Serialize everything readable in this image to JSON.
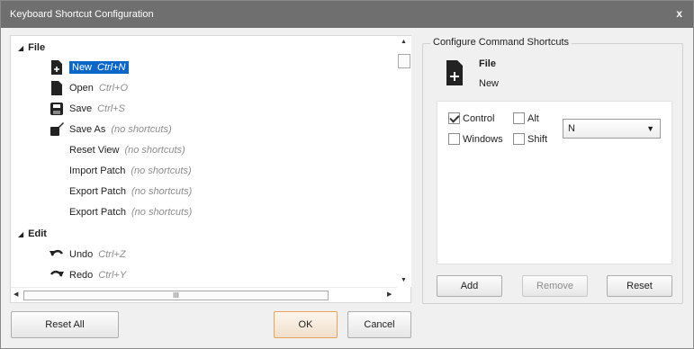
{
  "window": {
    "title": "Keyboard Shortcut Configuration",
    "close_label": "x"
  },
  "tree": {
    "groups": [
      {
        "label": "File",
        "items": [
          {
            "name": "New",
            "shortcut": "Ctrl+N",
            "icon": "new-file-icon",
            "selected": true
          },
          {
            "name": "Open",
            "shortcut": "Ctrl+O",
            "icon": "open-file-icon"
          },
          {
            "name": "Save",
            "shortcut": "Ctrl+S",
            "icon": "save-icon"
          },
          {
            "name": "Save As",
            "shortcut": "(no shortcuts)",
            "icon": "save-as-icon"
          },
          {
            "name": "Reset View",
            "shortcut": "(no shortcuts)"
          },
          {
            "name": "Import Patch",
            "shortcut": "(no shortcuts)"
          },
          {
            "name": "Export Patch",
            "shortcut": "(no shortcuts)"
          },
          {
            "name": "Export Patch",
            "shortcut": "(no shortcuts)"
          }
        ]
      },
      {
        "label": "Edit",
        "items": [
          {
            "name": "Undo",
            "shortcut": "Ctrl+Z",
            "icon": "undo-icon"
          },
          {
            "name": "Redo",
            "shortcut": "Ctrl+Y",
            "icon": "redo-icon"
          }
        ]
      }
    ],
    "hscroll_grip": "III"
  },
  "buttons": {
    "reset_all": "Reset All",
    "ok": "OK",
    "cancel": "Cancel"
  },
  "panel": {
    "title": "Configure Command Shortcuts",
    "command_group": "File",
    "command_name": "New",
    "modifiers": {
      "control": {
        "label": "Control",
        "checked": true
      },
      "alt": {
        "label": "Alt",
        "checked": false
      },
      "windows": {
        "label": "Windows",
        "checked": false
      },
      "shift": {
        "label": "Shift",
        "checked": false
      }
    },
    "key_value": "N",
    "add_label": "Add",
    "remove_label": "Remove",
    "reset_label": "Reset"
  },
  "colors": {
    "titlebar": "#6f6f6f",
    "selection": "#0a67c8",
    "ok_border": "#e8a35a"
  }
}
